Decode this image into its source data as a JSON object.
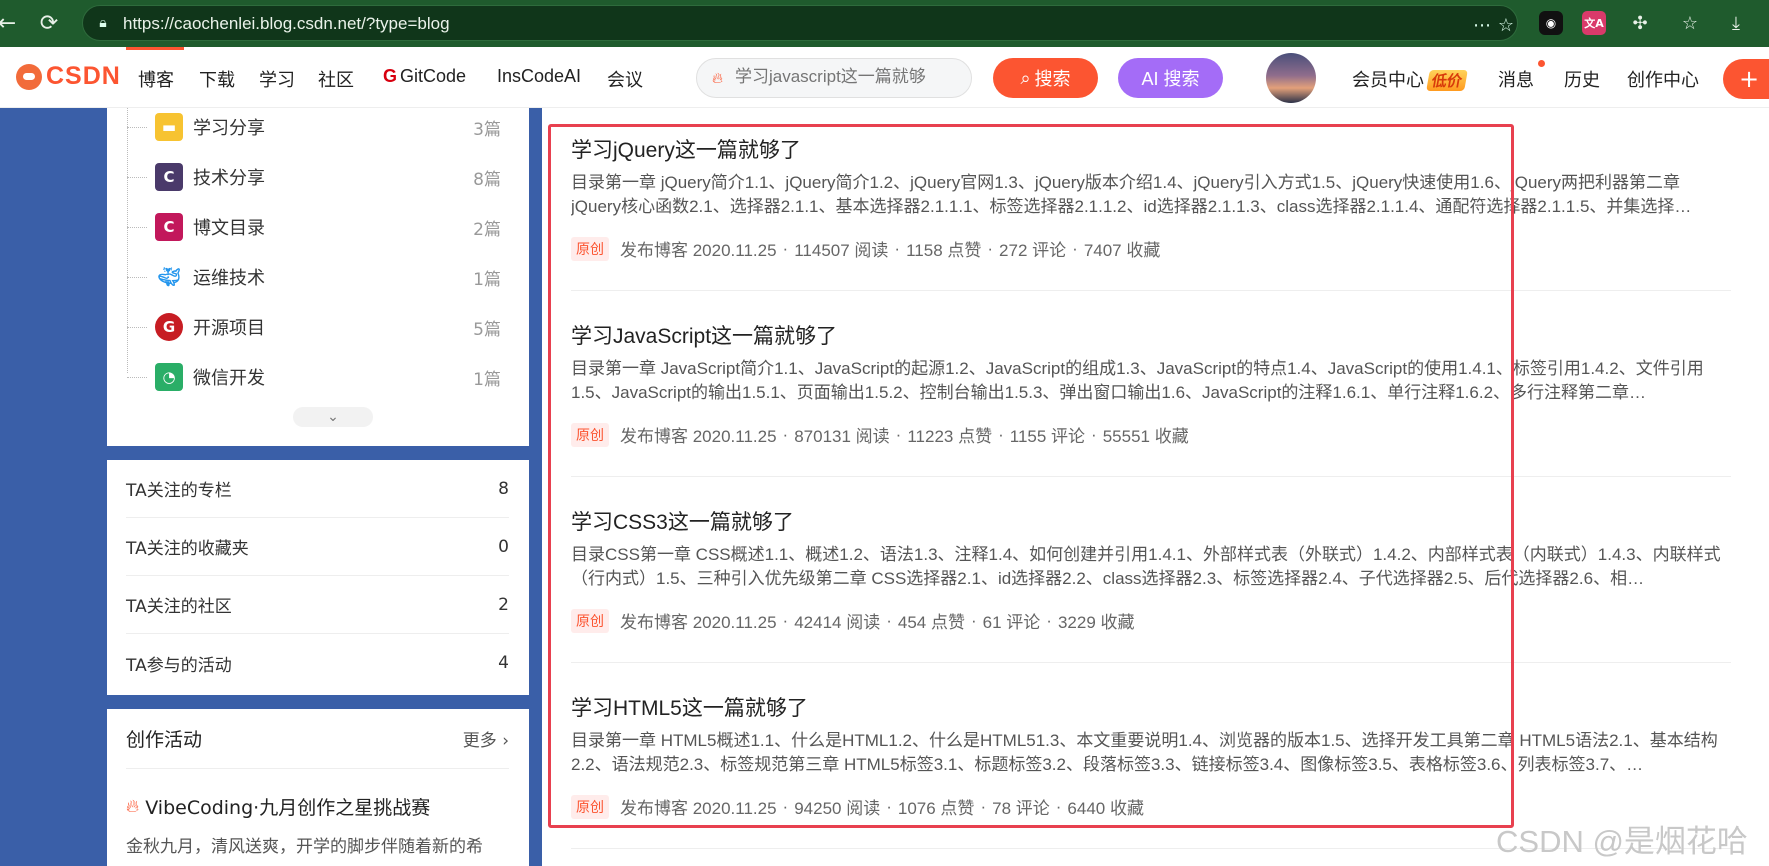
{
  "browser": {
    "url": "https://caochenlei.blog.csdn.net/?type=blog"
  },
  "toolbar": {
    "logo_text": "CSDN",
    "nav": [
      "博客",
      "下载",
      "学习",
      "社区",
      "GitCode",
      "InsCodeAI",
      "会议"
    ],
    "search_placeholder": "学习javascript这一篇就够",
    "search_button": "搜索",
    "ai_search_button": "AI 搜索",
    "vip_center": "会员中心",
    "vip_badge": "低价",
    "messages": "消息",
    "history": "历史",
    "create_center": "创作中心",
    "publish": "+"
  },
  "categories": [
    {
      "name": "学习分享",
      "count": "3篇",
      "icon": "folder-icon",
      "color": "#f7c331"
    },
    {
      "name": "技术分享",
      "count": "8篇",
      "icon": "c-logo-icon",
      "color": "#4a3a6a"
    },
    {
      "name": "博文目录",
      "count": "2篇",
      "icon": "c-logo-icon",
      "color": "#c2185b"
    },
    {
      "name": "运维技术",
      "count": "1篇",
      "icon": "docker-icon",
      "color": "#2496ed"
    },
    {
      "name": "开源项目",
      "count": "5篇",
      "icon": "gitee-icon",
      "color": "#c71d23"
    },
    {
      "name": "微信开发",
      "count": "1篇",
      "icon": "wechat-icon",
      "color": "#2aae67"
    }
  ],
  "follows": [
    {
      "label": "TA关注的专栏",
      "value": "8"
    },
    {
      "label": "TA关注的收藏夹",
      "value": "0"
    },
    {
      "label": "TA关注的社区",
      "value": "2"
    },
    {
      "label": "TA参与的活动",
      "value": "4"
    }
  ],
  "activity": {
    "title": "创作活动",
    "more": "更多",
    "event_title": "VibeCoding·九月创作之星挑战赛",
    "event_desc": "金秋九月，清风送爽，开学的脚步伴随着新的希"
  },
  "articles": [
    {
      "title": "学习jQuery这一篇就够了",
      "desc": "目录第一章 jQuery简介1.1、jQuery简介1.2、jQuery官网1.3、jQuery版本介绍1.4、jQuery引入方式1.5、jQuery快速使用1.6、jQuery两把利器第二章 jQuery核心函数2.1、选择器2.1.1、基本选择器2.1.1.1、标签选择器2.1.1.2、id选择器2.1.1.3、class选择器2.1.1.4、通配符选择器2.1.1.5、并集选择…",
      "tag": "原创",
      "published": "发布博客 2020.11.25",
      "reads": "114507 阅读",
      "likes": "1158 点赞",
      "comments": "272 评论",
      "favorites": "7407 收藏"
    },
    {
      "title": "学习JavaScript这一篇就够了",
      "desc": "目录第一章 JavaScript简介1.1、JavaScript的起源1.2、JavaScript的组成1.3、JavaScript的特点1.4、JavaScript的使用1.4.1、标签引用1.4.2、文件引用1.5、JavaScript的输出1.5.1、页面输出1.5.2、控制台输出1.5.3、弹出窗口输出1.6、JavaScript的注释1.6.1、单行注释1.6.2、多行注释第二章…",
      "tag": "原创",
      "published": "发布博客 2020.11.25",
      "reads": "870131 阅读",
      "likes": "11223 点赞",
      "comments": "1155 评论",
      "favorites": "55551 收藏"
    },
    {
      "title": "学习CSS3这一篇就够了",
      "desc": "目录CSS第一章 CSS概述1.1、概述1.2、语法1.3、注释1.4、如何创建并引用1.4.1、外部样式表（外联式）1.4.2、内部样式表（内联式）1.4.3、内联样式（行内式）1.5、三种引入优先级第二章 CSS选择器2.1、id选择器2.2、class选择器2.3、标签选择器2.4、子代选择器2.5、后代选择器2.6、相…",
      "tag": "原创",
      "published": "发布博客 2020.11.25",
      "reads": "42414 阅读",
      "likes": "454 点赞",
      "comments": "61 评论",
      "favorites": "3229 收藏"
    },
    {
      "title": "学习HTML5这一篇就够了",
      "desc": "目录第一章 HTML5概述1.1、什么是HTML1.2、什么是HTML51.3、本文重要说明1.4、浏览器的版本1.5、选择开发工具第二章 HTML5语法2.1、基本结构2.2、语法规范2.3、标签规范第三章 HTML5标签3.1、标题标签3.2、段落标签3.3、链接标签3.4、图像标签3.5、表格标签3.6、列表标签3.7、…",
      "tag": "原创",
      "published": "发布博客 2020.11.25",
      "reads": "94250 阅读",
      "likes": "1076 点赞",
      "comments": "78 评论",
      "favorites": "6440 收藏"
    }
  ],
  "watermark": "CSDN @是烟花哈"
}
